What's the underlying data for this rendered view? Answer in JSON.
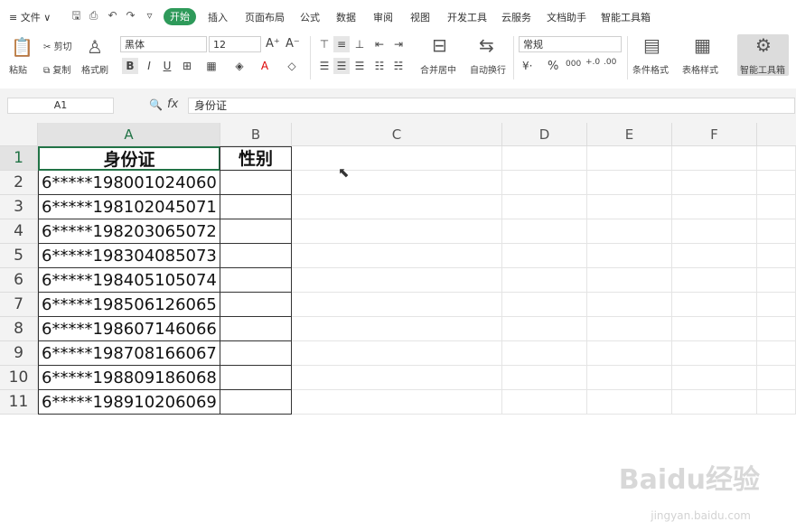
{
  "menubar": {
    "file": "≡ 文件 ∨",
    "start": "开始",
    "tabs": [
      "插入",
      "页面布局",
      "公式",
      "数据",
      "审阅",
      "视图",
      "开发工具",
      "云服务",
      "文档助手",
      "智能工具箱"
    ]
  },
  "ribbon": {
    "paste": "粘贴",
    "cut": "剪切",
    "copy": "复制",
    "format_painter": "格式刷",
    "font_name": "黑体",
    "font_size": "12",
    "bold": "B",
    "italic": "I",
    "underline": "U",
    "merge_center": "合并居中",
    "auto_wrap": "自动换行",
    "number_format": "常规",
    "percent": "%",
    "thousands": "000",
    "cond_format": "条件格式",
    "table_style": "表格样式",
    "smart_toolbox": "智能工具箱"
  },
  "formula_bar": {
    "name_box": "A1",
    "fx": "fx",
    "content": "身份证"
  },
  "columns": [
    "A",
    "B",
    "C",
    "D",
    "E",
    "F"
  ],
  "rows": [
    "1",
    "2",
    "3",
    "4",
    "5",
    "6",
    "7",
    "8",
    "9",
    "10",
    "11"
  ],
  "table": {
    "header_a": "身份证",
    "header_b": "性别",
    "ids": [
      "6*****198001024060",
      "6*****198102045071",
      "6*****198203065072",
      "6*****198304085073",
      "6*****198405105074",
      "6*****198506126065",
      "6*****198607146066",
      "6*****198708166067",
      "6*****198809186068",
      "6*****198910206069"
    ]
  },
  "watermark": {
    "logo": "Baidu经验",
    "url": "jingyan.baidu.com"
  },
  "colors": {
    "accent": "#2e9a5a",
    "selection": "#217346"
  }
}
